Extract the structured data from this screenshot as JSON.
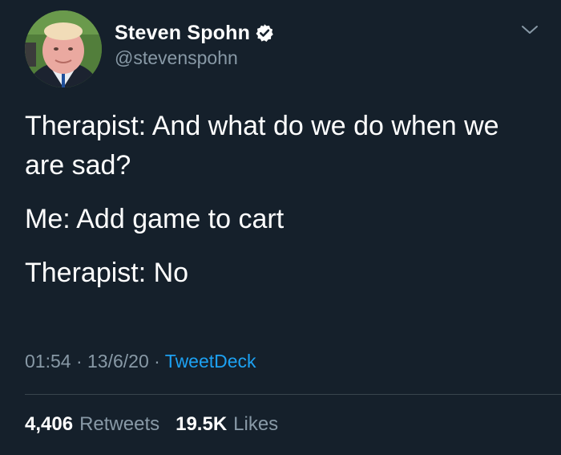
{
  "author": {
    "display_name": "Steven Spohn",
    "handle": "@stevenspohn",
    "verified_icon": "verified-badge-icon",
    "avatar_icon": "profile-avatar"
  },
  "menu": {
    "icon": "chevron-down-icon"
  },
  "tweet": {
    "lines": [
      "Therapist: And what do we do when we are sad?",
      "Me: Add game to cart",
      "Therapist: No"
    ]
  },
  "meta": {
    "time": "01:54",
    "separator1": " · ",
    "date": "13/6/20",
    "separator2": " · ",
    "source": "TweetDeck"
  },
  "stats": {
    "retweets_count": "4,406",
    "retweets_label": "Retweets",
    "likes_count": "19.5K",
    "likes_label": "Likes"
  },
  "colors": {
    "background": "#15202b",
    "secondary_text": "#8899a6",
    "link": "#1da1f2",
    "divider": "#38444d"
  }
}
